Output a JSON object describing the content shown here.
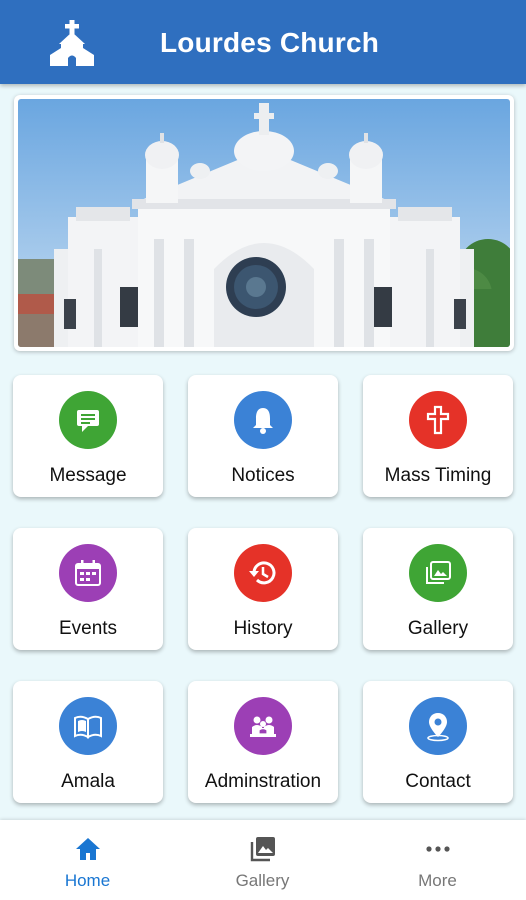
{
  "app": {
    "title": "Lourdes Church"
  },
  "hero": {
    "alt_icon": "church-photo"
  },
  "tiles": [
    {
      "label": "Message",
      "icon": "message-icon",
      "color": "#3fa535"
    },
    {
      "label": "Notices",
      "icon": "bell-icon",
      "color": "#3b82d6"
    },
    {
      "label": "Mass Timing",
      "icon": "cross-icon",
      "color": "#e53228"
    },
    {
      "label": "Events",
      "icon": "calendar-icon",
      "color": "#9c3fb5"
    },
    {
      "label": "History",
      "icon": "history-icon",
      "color": "#e53228"
    },
    {
      "label": "Gallery",
      "icon": "gallery-icon",
      "color": "#3fa535"
    },
    {
      "label": "Amala",
      "icon": "book-icon",
      "color": "#3b82d6"
    },
    {
      "label": "Adminstration",
      "icon": "people-icon",
      "color": "#9c3fb5"
    },
    {
      "label": "Contact",
      "icon": "location-pin-icon",
      "color": "#3b82d6"
    }
  ],
  "bottom_nav": [
    {
      "label": "Home",
      "icon": "home-icon",
      "active": true
    },
    {
      "label": "Gallery",
      "icon": "photo-library-icon",
      "active": false
    },
    {
      "label": "More",
      "icon": "more-dots-icon",
      "active": false
    }
  ],
  "colors": {
    "appbar": "#2f6fbf",
    "background": "#eaf8fb",
    "active_nav": "#1976d2"
  }
}
